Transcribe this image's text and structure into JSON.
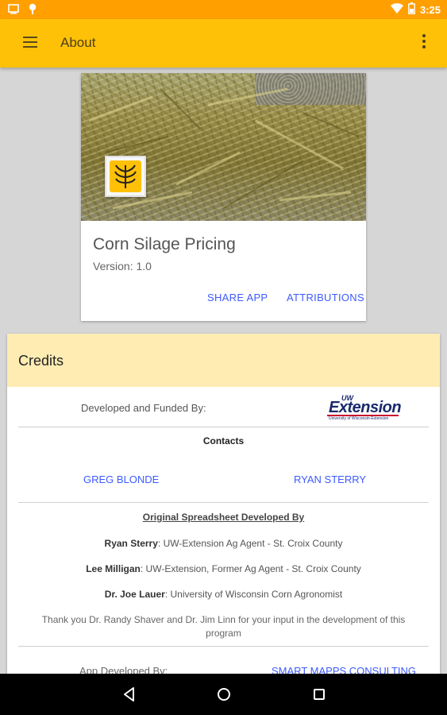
{
  "status_bar": {
    "time": "3:25",
    "icons": [
      "screenshot-icon",
      "location-pin-icon",
      "wifi-icon",
      "battery-icon"
    ]
  },
  "toolbar": {
    "title": "About",
    "menu_icon": "hamburger-menu-icon",
    "overflow_icon": "more-vert-icon"
  },
  "app_card": {
    "name": "Corn Silage Pricing",
    "version": "Version: 1.0",
    "share_label": "SHARE APP",
    "attributions_label": "ATTRIBUTIONS"
  },
  "credits": {
    "title": "Credits",
    "funded_label": "Developed and Funded By:",
    "funder_logo": {
      "top": "UW",
      "main": "Extension",
      "sub": "University of Wisconsin-Extension"
    },
    "contacts_heading": "Contacts",
    "contacts": [
      "GREG BLONDE",
      "RYAN STERRY"
    ],
    "original_heading": "Original Spreadsheet Developed By",
    "people": [
      {
        "name": "Ryan Sterry",
        "role": ": UW-Extension Ag Agent - St. Croix County"
      },
      {
        "name": "Lee Milligan",
        "role": ": UW-Extension, Former Ag Agent - St. Croix County"
      },
      {
        "name": "Dr. Joe Lauer",
        "role": ": University of Wisconsin Corn Agronomist"
      }
    ],
    "thanks": "Thank you Dr. Randy Shaver and Dr. Jim Linn for your input in the development of this program",
    "app_dev_label": "App Developed By:",
    "app_dev_link": "SMART MAPPS CONSULTING"
  },
  "colors": {
    "status_bar": "#ffa000",
    "toolbar": "#ffc107",
    "credits_header": "#ffecb3",
    "link": "#3d5afe"
  },
  "nav_bar": {
    "icons": [
      "back-icon",
      "home-icon",
      "recents-icon"
    ]
  }
}
